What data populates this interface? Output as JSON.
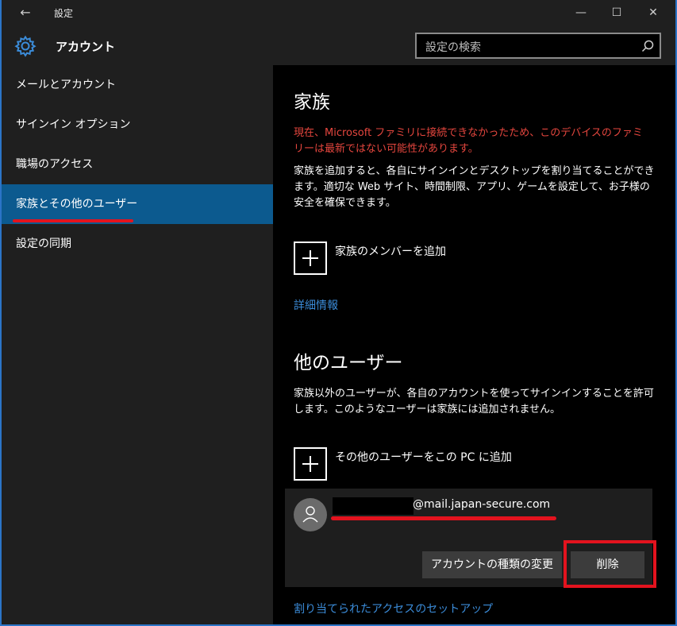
{
  "titlebar": {
    "back_icon": "←",
    "title": "設定",
    "minimize": "—",
    "maximize": "☐",
    "close": "✕"
  },
  "header": {
    "title": "アカウント",
    "search_placeholder": "設定の検索"
  },
  "sidebar": {
    "items": [
      {
        "label": "メールとアカウント",
        "active": false
      },
      {
        "label": "サインイン オプション",
        "active": false
      },
      {
        "label": "職場のアクセス",
        "active": false
      },
      {
        "label": "家族とその他のユーザー",
        "active": true
      },
      {
        "label": "設定の同期",
        "active": false
      }
    ]
  },
  "family": {
    "heading": "家族",
    "warning": "現在、Microsoft ファミリに接続できなかったため、このデバイスのファミリーは最新ではない可能性があります。",
    "description": "家族を追加すると、各自にサインインとデスクトップを割り当てることができます。適切な Web サイト、時間制限、アプリ、ゲームを設定して、お子様の安全を確保できます。",
    "add_label": "家族のメンバーを追加",
    "details_link": "詳細情報"
  },
  "other_users": {
    "heading": "他のユーザー",
    "description": "家族以外のユーザーが、各自のアカウントを使ってサインインすることを許可します。このようなユーザーは家族には追加されません。",
    "add_label": "その他のユーザーをこの PC に追加",
    "user_email": "@mail.japan-secure.com",
    "change_type_button": "アカウントの種類の変更",
    "delete_button": "削除",
    "assigned_access_link": "割り当てられたアクセスのセットアップ"
  },
  "colors": {
    "accent": "#0c5a8f",
    "warning": "#e5463e",
    "link": "#3b8cd9",
    "annotation": "#e3131e"
  }
}
